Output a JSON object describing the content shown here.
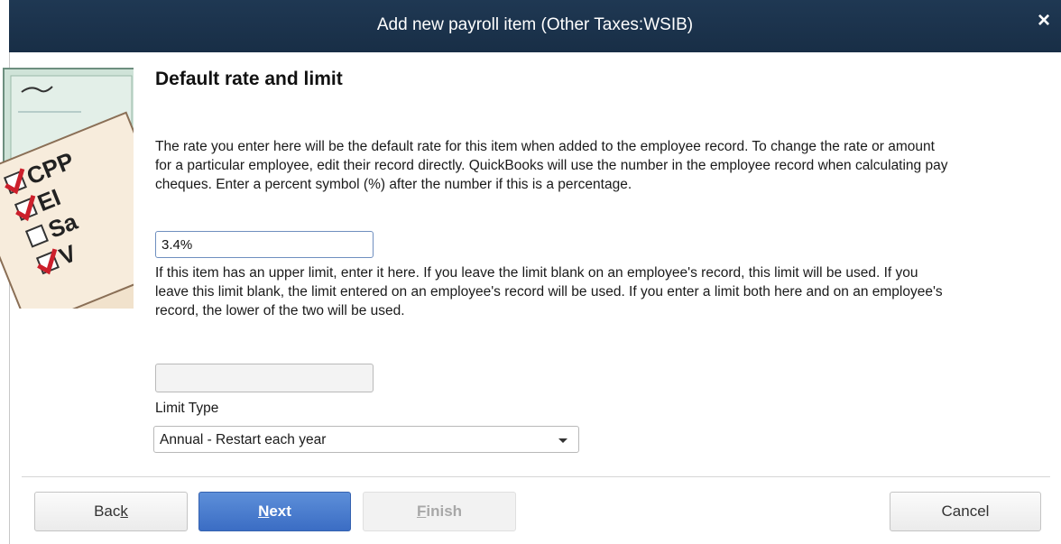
{
  "window": {
    "title": "Add new payroll item (Other Taxes:WSIB)",
    "close_icon": "close-icon",
    "titlebar_color": "#1b3249"
  },
  "side_image": {
    "icon": "payroll-checklist-illustration",
    "items": [
      "CPP",
      "EI",
      "Sa",
      "V"
    ],
    "checked": [
      true,
      true,
      false,
      true
    ]
  },
  "page": {
    "heading": "Default rate and limit",
    "rate_description": "The rate you enter here will be the default rate for this item when added to the employee record. To change the rate or amount for a particular employee, edit their record directly.  QuickBooks will use the number in the employee record when calculating pay cheques.  Enter a percent symbol (%) after the number if this is a percentage.",
    "rate_value": "3.4%",
    "limit_description": "If this item has an upper limit, enter it here. If you leave the limit blank on an employee's record, this limit will be used.  If you leave this limit blank, the limit entered on an employee's record will be used.  If you enter a limit both here and on an employee's  record, the lower of the two will be used.",
    "limit_value": "",
    "limit_type_label": "Limit Type",
    "limit_type_selected": "Annual - Restart each year"
  },
  "buttons": {
    "back_pre": "Bac",
    "back_mnemonic": "k",
    "next_mnemonic": "N",
    "next_post": "ext",
    "finish_mnemonic": "F",
    "finish_post": "inish",
    "cancel": "Cancel",
    "next_color": "#4a7ccd"
  }
}
